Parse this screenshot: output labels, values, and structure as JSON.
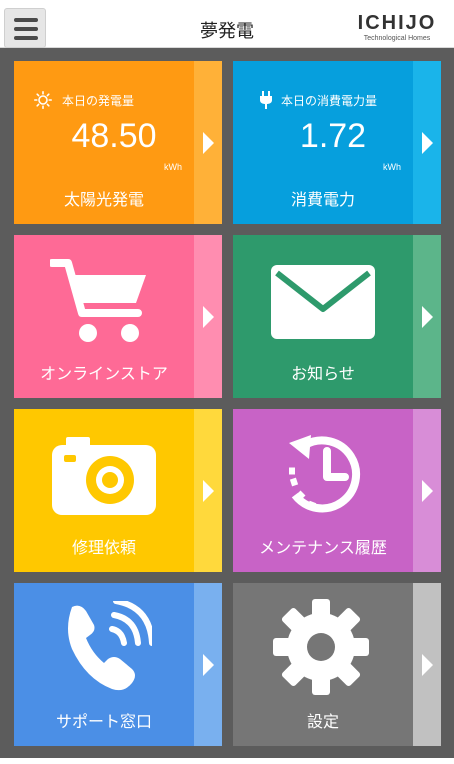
{
  "header": {
    "title": "夢発電",
    "brand_name": "ICHIJO",
    "brand_sub": "Technological Homes"
  },
  "tiles": {
    "solar": {
      "heading": "本日の発電量",
      "value": "48.50",
      "unit": "kWh",
      "label": "太陽光発電",
      "icon": "sun-icon",
      "color": "#ff9a12"
    },
    "consumption": {
      "heading": "本日の消費電力量",
      "value": "1.72",
      "unit": "kWh",
      "label": "消費電力",
      "icon": "plug-icon",
      "color": "#069fdd"
    },
    "store": {
      "label": "オンラインストア",
      "icon": "cart-icon",
      "color": "#fe6a96"
    },
    "news": {
      "label": "お知らせ",
      "icon": "mail-icon",
      "color": "#2e9a6c"
    },
    "repair": {
      "label": "修理依頼",
      "icon": "camera-icon",
      "color": "#ffc800"
    },
    "history": {
      "label": "メンテナンス履歴",
      "icon": "history-icon",
      "color": "#c863c6"
    },
    "support": {
      "label": "サポート窓口",
      "icon": "phone-icon",
      "color": "#4b8fe6"
    },
    "settings": {
      "label": "設定",
      "icon": "gear-icon",
      "color": "#767676"
    }
  }
}
